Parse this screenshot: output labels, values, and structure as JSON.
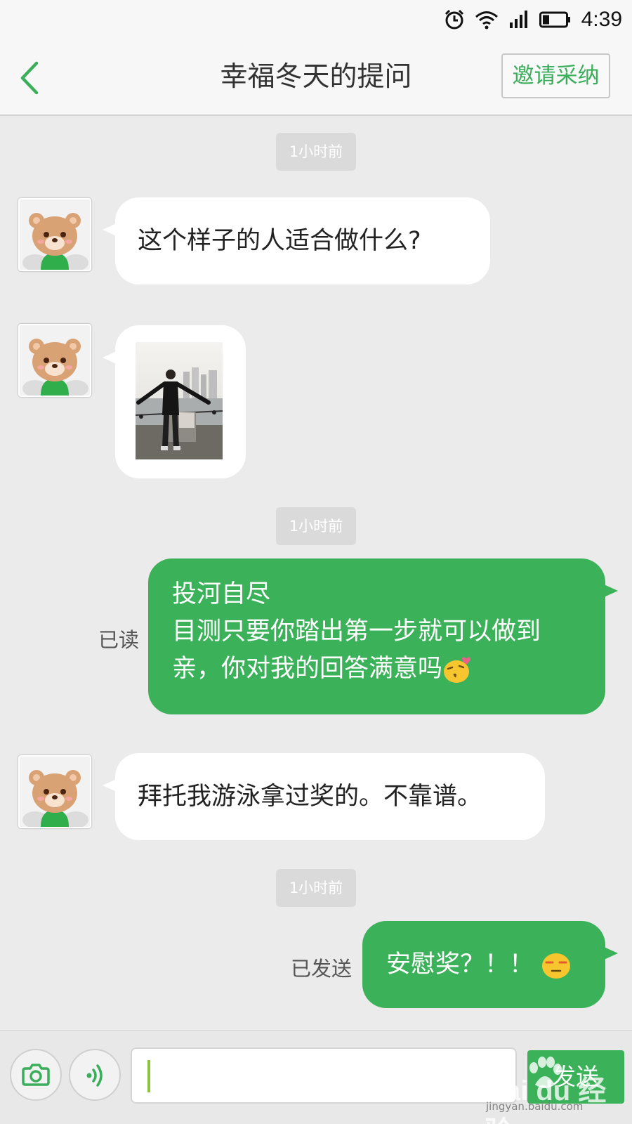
{
  "status_bar": {
    "time": "4:39"
  },
  "header": {
    "title": "幸福冬天的提问",
    "invite_label": "邀请采纳"
  },
  "colors": {
    "accent": "#3bb25a",
    "bubble_self": "#3bb25a",
    "bubble_other": "#ffffff",
    "background": "#ebebeb"
  },
  "messages": [
    {
      "timestamp": "1小时前"
    },
    {
      "text": "这个样子的人适合做什么?"
    },
    {
      "type": "image"
    },
    {
      "timestamp": "1小时前"
    },
    {
      "lines": [
        "投河自尽",
        "目测只要你踏出第一步就可以做到",
        "亲，你对我的回答满意吗"
      ],
      "status": "已读",
      "emoji": "kiss-emoji"
    },
    {
      "text": "拜托我游泳拿过奖的。不靠谱。"
    },
    {
      "timestamp": "1小时前"
    },
    {
      "text": "安慰奖？！！",
      "status": "已发送",
      "emoji": "unamused-emoji"
    }
  ],
  "input_bar": {
    "send_label": "发送",
    "input_value": ""
  },
  "watermark": {
    "brand": "Bai du 经验",
    "url": "jingyan.baidu.com"
  }
}
